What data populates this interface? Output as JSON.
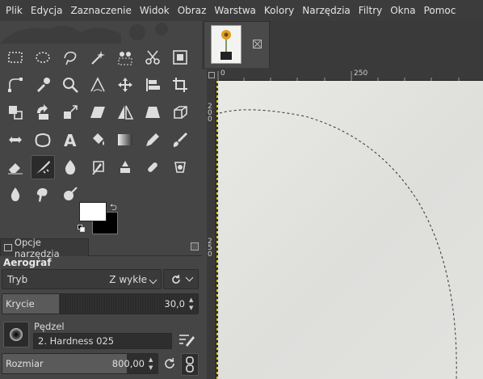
{
  "menubar": {
    "items": [
      "Plik",
      "Edycja",
      "Zaznaczenie",
      "Widok",
      "Obraz",
      "Warstwa",
      "Kolory",
      "Narzędzia",
      "Filtry",
      "Okna",
      "Pomoc"
    ]
  },
  "toolbox": {
    "tools": [
      "rect-select-icon",
      "ellipse-select-icon",
      "free-select-icon",
      "fuzzy-select-icon",
      "select-by-color-icon",
      "scissors-select-icon",
      "foreground-select-icon",
      "paths-icon",
      "color-picker-icon",
      "zoom-icon",
      "measure-icon",
      "move-icon",
      "align-icon",
      "crop-icon",
      "unified-transform-icon",
      "rotate-icon",
      "scale-icon",
      "shear-icon",
      "flip-icon",
      "perspective-icon",
      "3d-transform-icon",
      "warp-icon",
      "cage-icon",
      "text-icon",
      "bucket-fill-icon",
      "gradient-icon",
      "pencil-icon",
      "paintbrush-icon",
      "eraser-icon",
      "airbrush-icon",
      "ink-icon",
      "mypaint-brush-icon",
      "clone-icon",
      "heal-icon",
      "perspective-clone-icon",
      "blur-icon",
      "smudge-icon",
      "dodge-burn-icon"
    ],
    "active_tool": "airbrush-icon",
    "colors": {
      "foreground": "#ffffff",
      "background": "#000000"
    }
  },
  "tool_options": {
    "tab_label": "Opcje narzędzia",
    "tool_name": "Aerograf",
    "mode_label": "Tryb",
    "mode_value": "Z wykłe",
    "opacity": {
      "label": "Krycie",
      "value": "30,0",
      "fraction": 0.3
    },
    "brush": {
      "label": "Pędzel",
      "name": "2. Hardness 025"
    },
    "size": {
      "label": "Rozmiar",
      "value": "800,00",
      "fraction": 0.8
    }
  },
  "image_window": {
    "hruler_labels": [
      "0",
      "250"
    ],
    "vruler_labels": [
      "200",
      "250"
    ]
  }
}
